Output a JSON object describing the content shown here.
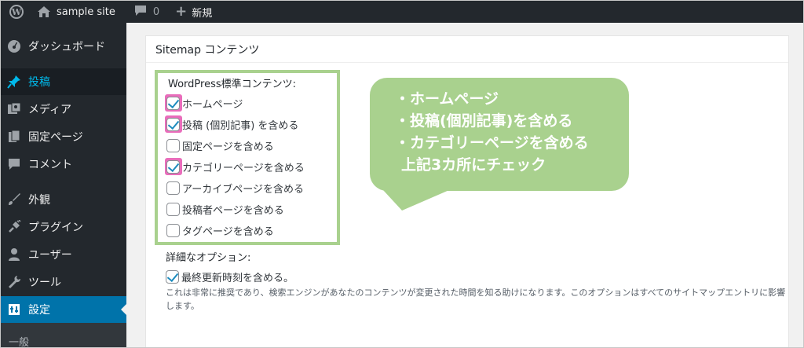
{
  "adminbar": {
    "site_name": "sample site",
    "comment_count": "0",
    "new_label": "新規"
  },
  "sidebar": {
    "items": [
      {
        "label": "ダッシュボード",
        "icon": "dashboard-icon"
      },
      {
        "label": "投稿",
        "icon": "pin-icon"
      },
      {
        "label": "メディア",
        "icon": "media-icon"
      },
      {
        "label": "固定ページ",
        "icon": "page-icon"
      },
      {
        "label": "コメント",
        "icon": "comment-icon"
      },
      {
        "label": "外観",
        "icon": "brush-icon"
      },
      {
        "label": "プラグイン",
        "icon": "plugin-icon"
      },
      {
        "label": "ユーザー",
        "icon": "user-icon"
      },
      {
        "label": "ツール",
        "icon": "wrench-icon"
      },
      {
        "label": "設定",
        "icon": "settings-icon"
      }
    ],
    "submenu_label": "一般"
  },
  "postbox": {
    "title": "Sitemap コンテンツ",
    "std_heading": "WordPress標準コンテンツ:",
    "checkboxes": [
      {
        "label": "ホームページ",
        "checked": true
      },
      {
        "label": "投稿 (個別記事) を含める",
        "checked": true
      },
      {
        "label": "固定ページを含める",
        "checked": false
      },
      {
        "label": "カテゴリーページを含める",
        "checked": true
      },
      {
        "label": "アーカイブページを含める",
        "checked": false
      },
      {
        "label": "投稿者ページを含める",
        "checked": false
      },
      {
        "label": "タグページを含める",
        "checked": false
      }
    ],
    "adv_heading": "詳細なオプション:",
    "adv_option": {
      "label": "最終更新時刻を含める。",
      "checked": true
    },
    "adv_desc": "これは非常に推奨であり、検索エンジンがあなたのコンテンツが変更された時間を知る助けになります。このオプションはすべてのサイトマップエントリに影響します。"
  },
  "callout": {
    "lines": [
      "・ホームページ",
      "・投稿(個別記事)を含める",
      "・カテゴリーページを含める",
      "上記3カ所にチェック"
    ]
  },
  "colors": {
    "adminbar_bg": "#23282d",
    "active_menu": "#0073aa",
    "callout_green": "#a9d18e",
    "highlight_pink": "#e96dbb",
    "checkmark_blue": "#1e8cbe"
  }
}
